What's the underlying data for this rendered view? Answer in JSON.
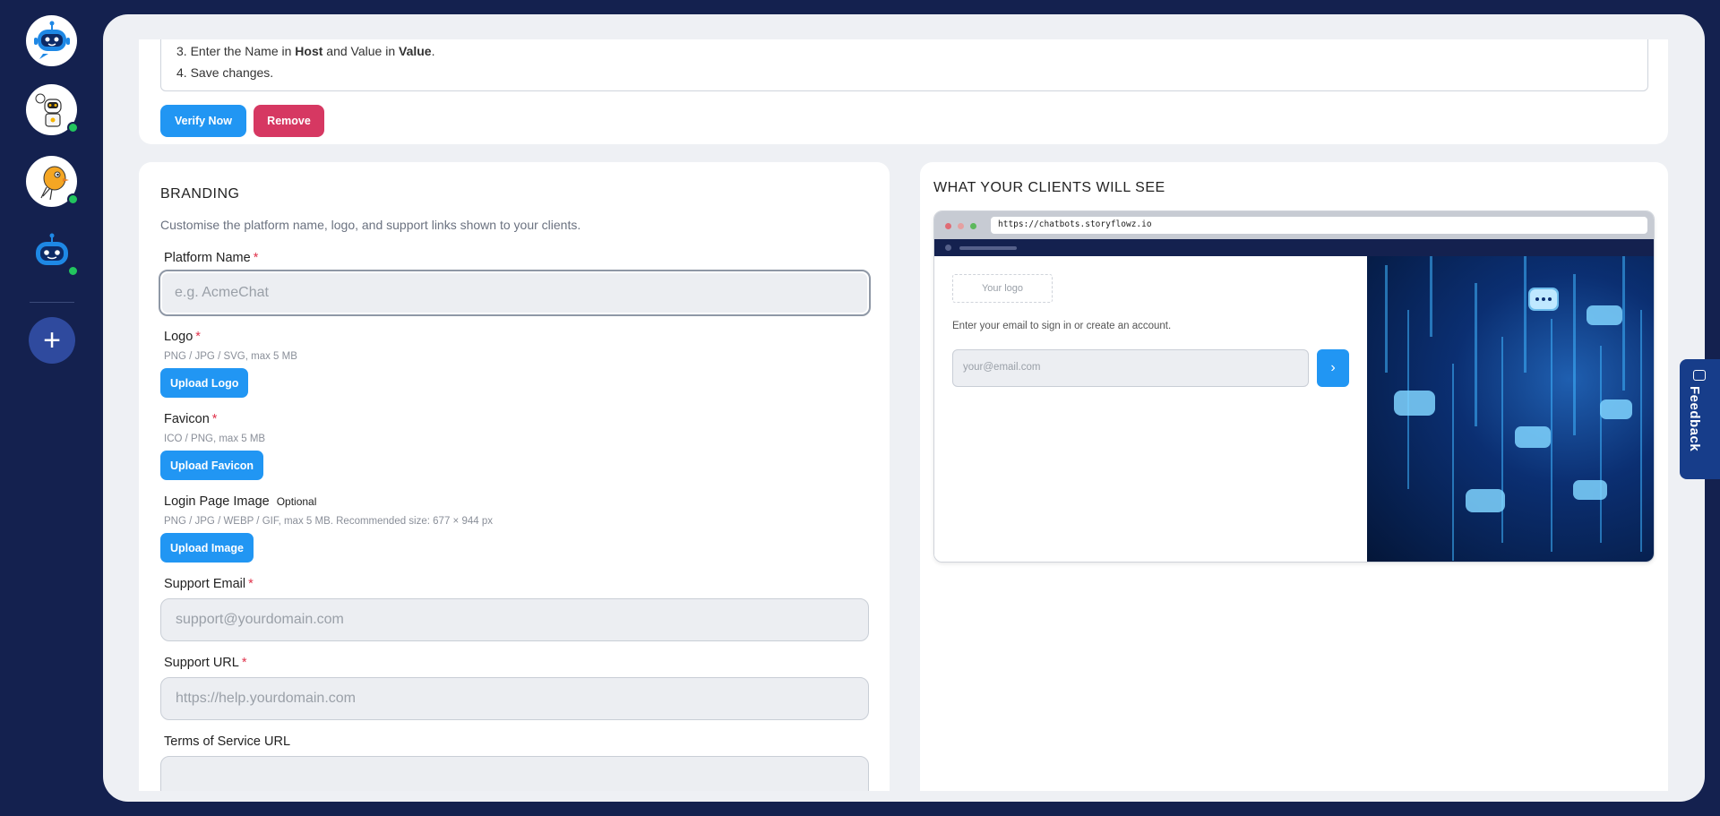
{
  "sidebar": {
    "bots": [
      {
        "name": "bot-avatar-1",
        "online": false
      },
      {
        "name": "bot-avatar-2",
        "online": true
      },
      {
        "name": "bot-avatar-3",
        "online": true
      },
      {
        "name": "bot-avatar-4",
        "online": true
      }
    ],
    "add_label": "+"
  },
  "domain_card": {
    "step3_prefix": "3. Enter the Name in ",
    "step3_host": "Host",
    "step3_mid": " and Value in ",
    "step3_value": "Value",
    "step3_suffix": ".",
    "step4": "4. Save changes.",
    "verify_label": "Verify Now",
    "remove_label": "Remove"
  },
  "branding": {
    "title": "BRANDING",
    "description": "Customise the platform name, logo, and support links shown to your clients.",
    "platform_name": {
      "label": "Platform Name",
      "required": "*",
      "placeholder": "e.g. AcmeChat"
    },
    "logo": {
      "label": "Logo",
      "required": "*",
      "hint": "PNG / JPG / SVG, max 5 MB",
      "button": "Upload Logo"
    },
    "favicon": {
      "label": "Favicon",
      "required": "*",
      "hint": "ICO / PNG, max 5 MB",
      "button": "Upload Favicon"
    },
    "login_image": {
      "label": "Login Page Image",
      "optional": "Optional",
      "hint": "PNG / JPG / WEBP / GIF, max 5 MB. Recommended size: 677 × 944 px",
      "button": "Upload Image"
    },
    "support_email": {
      "label": "Support Email",
      "required": "*",
      "placeholder": "support@yourdomain.com"
    },
    "support_url": {
      "label": "Support URL",
      "required": "*",
      "placeholder": "https://help.yourdomain.com"
    },
    "terms_url": {
      "label": "Terms of Service URL"
    }
  },
  "preview": {
    "title": "WHAT YOUR CLIENTS WILL SEE",
    "url": "https://chatbots.storyflowz.io",
    "logo_placeholder": "Your logo",
    "prompt": "Enter your email to sign in or create an account.",
    "email_placeholder": "your@email.com",
    "go_icon": "chevron-right-icon"
  },
  "feedback": {
    "label": "Feedback"
  },
  "colors": {
    "accent": "#2196f3",
    "danger": "#d63862",
    "nav": "#14214f",
    "online": "#22c55e"
  }
}
